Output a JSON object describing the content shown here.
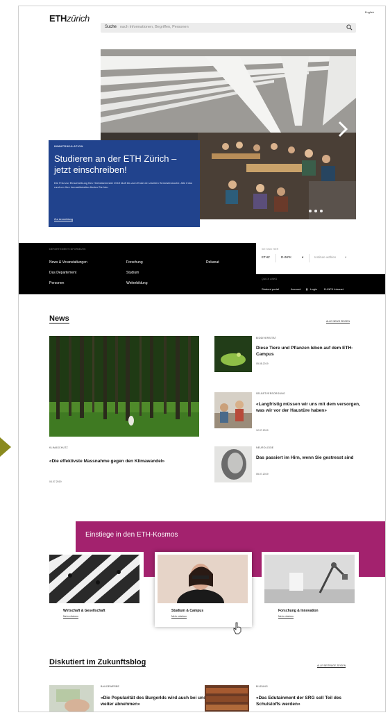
{
  "header": {
    "logo_bold": "ETH",
    "logo_light": "zürich",
    "lang": "English",
    "search_label": "Suche",
    "search_placeholder": "nach Informationen, Begriffen, Personen"
  },
  "hero": {
    "kicker": "IMMATRIKULATION",
    "title": "Studieren an der ETH Zürich – jetzt einschreiben!",
    "text": "Die Frist zur Einschreibung fürs Herbstsemester 2019 läuft bis zum Ende der zweiten Semesterwoche. Alle Infos rund um Ihre Immatrikulation finden Sie hier.",
    "link": "Zur Anmeldung",
    "slides": 3
  },
  "nav": {
    "caption": "DEPARTEMENT INFORMATIK",
    "col1": [
      "News & Veranstaltungen",
      "Das Departement",
      "Personen"
    ],
    "col2": [
      "Forschung",
      "Studium",
      "Weiterbildung"
    ],
    "col3": [
      "Dekanat"
    ],
    "side_caption": "SIE SIND HIER",
    "crumb1": "ETHZ",
    "crumb2": "D-INFK",
    "crumb3": "Institute wählen",
    "links_caption": "QUICK LINKS",
    "quicklinks": [
      "Student portal",
      "Account",
      "Login",
      "D-INFK Intranet"
    ]
  },
  "news": {
    "heading": "News",
    "all": "ALLE NEWS ZEIGEN",
    "main": {
      "category": "KLIMASCHUTZ",
      "title": "«Die effektivste Massnahme gegen den Klimawandel»",
      "date": "04.07.2019"
    },
    "items": [
      {
        "category": "BIODIVERSITÄT",
        "title": "Diese Tiere und Pflanzen leben auf dem ETH-Campus",
        "date": "05.08.2019"
      },
      {
        "category": "SELBSTVERSORGUNG",
        "title": "«Langfristig müssen wir uns mit dem versorgen, was wir vor der Haustüre haben»",
        "date": "12.07.2019"
      },
      {
        "category": "NEUROLOGIE",
        "title": "Das passiert im Hirn, wenn Sie gestresst sind",
        "date": "05.07.2019"
      }
    ]
  },
  "kosmos": {
    "title": "Einstiege in den ETH-Kosmos",
    "cards": [
      {
        "label": "Wirtschaft & Gesellschaft",
        "link": "Mehr erfahren"
      },
      {
        "label": "Studium & Campus",
        "link": "Mehr erfahren"
      },
      {
        "label": "Forschung & Innovation",
        "link": "Mehr erfahren"
      }
    ]
  },
  "blog": {
    "heading": "Diskutiert im Zukunftsblog",
    "all": "ALLE BEITRÄGE ZEIGEN",
    "items": [
      {
        "category": "BAUGEWERBE",
        "title": "«Die Popularität des Burgerlds wird auch bei uns weiter abnehmen»"
      },
      {
        "category": "BILDUNG",
        "title": "«Das Edutainment der SRG soll Teil des Schulstoffs werden»"
      }
    ]
  },
  "colors": {
    "hero_blue": "#21438d",
    "kosmos_magenta": "#a3226e",
    "nav_black": "#000000"
  }
}
